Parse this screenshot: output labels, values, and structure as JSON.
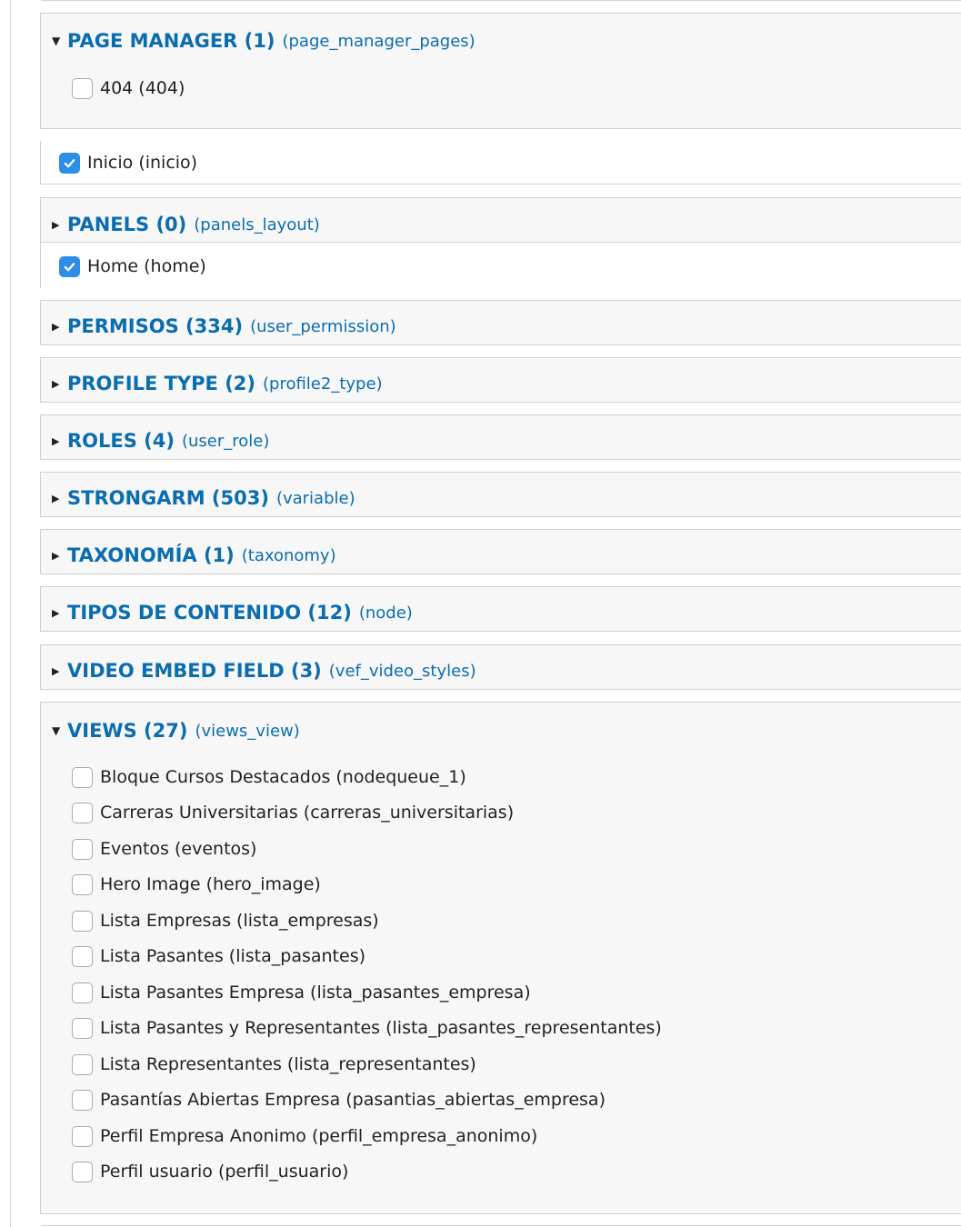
{
  "page_manager": {
    "title": "PAGE MANAGER (1)",
    "machine": "(page_manager_pages)",
    "items": [
      {
        "label": "404 (404)",
        "checked": false
      }
    ]
  },
  "inicio_item": {
    "label": "Inicio (inicio)",
    "checked": true
  },
  "panels": {
    "title": "PANELS (0)",
    "machine": "(panels_layout)",
    "items": [
      {
        "label": "Home (home)",
        "checked": true
      }
    ]
  },
  "permisos": {
    "title": "PERMISOS (334)",
    "machine": "(user_permission)"
  },
  "profile_type": {
    "title": "PROFILE TYPE (2)",
    "machine": "(profile2_type)"
  },
  "roles": {
    "title": "ROLES (4)",
    "machine": "(user_role)"
  },
  "strongarm": {
    "title": "STRONGARM (503)",
    "machine": "(variable)"
  },
  "taxonomia": {
    "title": "TAXONOMÍA (1)",
    "machine": "(taxonomy)"
  },
  "tipos_contenido": {
    "title": "TIPOS DE CONTENIDO (12)",
    "machine": "(node)"
  },
  "video_embed": {
    "title": "VIDEO EMBED FIELD (3)",
    "machine": "(vef_video_styles)"
  },
  "views": {
    "title": "VIEWS (27)",
    "machine": "(views_view)",
    "items": [
      {
        "label": "Bloque Cursos Destacados (nodequeue_1)",
        "checked": false
      },
      {
        "label": "Carreras Universitarias (carreras_universitarias)",
        "checked": false
      },
      {
        "label": "Eventos (eventos)",
        "checked": false
      },
      {
        "label": "Hero Image (hero_image)",
        "checked": false
      },
      {
        "label": "Lista Empresas (lista_empresas)",
        "checked": false
      },
      {
        "label": "Lista Pasantes (lista_pasantes)",
        "checked": false
      },
      {
        "label": "Lista Pasantes Empresa (lista_pasantes_empresa)",
        "checked": false
      },
      {
        "label": "Lista Pasantes y Representantes (lista_pasantes_representantes)",
        "checked": false
      },
      {
        "label": "Lista Representantes (lista_representantes)",
        "checked": false
      },
      {
        "label": "Pasantías Abiertas Empresa (pasantias_abiertas_empresa)",
        "checked": false
      },
      {
        "label": "Perfil Empresa Anonimo (perfil_empresa_anonimo)",
        "checked": false
      },
      {
        "label": "Perfil usuario (perfil_usuario)",
        "checked": false
      }
    ]
  },
  "icons": {
    "expanded": "triangle-down-icon",
    "collapsed": "triangle-right-icon",
    "check": "checkmark-icon"
  },
  "colors": {
    "link": "#0a6db0",
    "checkbox_checked": "#2d8ee8",
    "fieldset_bg": "#f7f7f7",
    "border": "#cfcfcf"
  }
}
